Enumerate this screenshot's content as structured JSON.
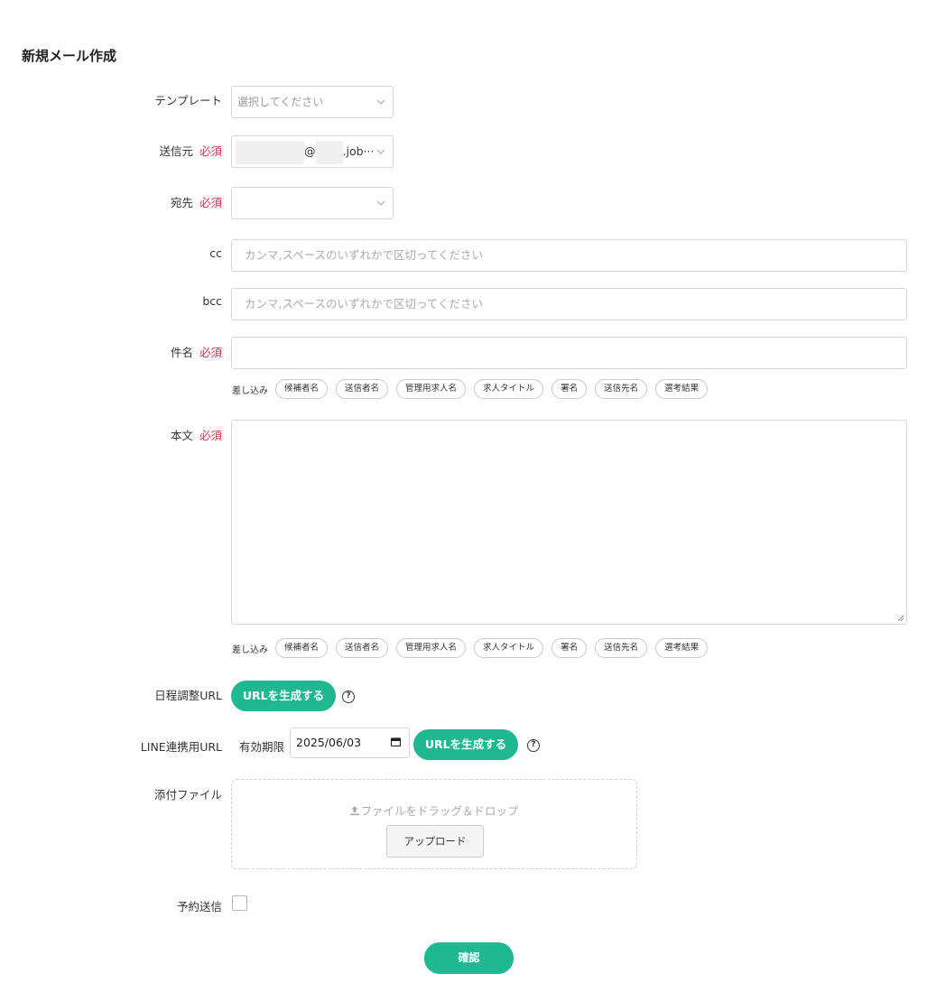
{
  "page": {
    "title": "新規メール作成"
  },
  "template": {
    "label": "テンプレート",
    "placeholder": "選択してください"
  },
  "from": {
    "label": "送信元",
    "required": "必須",
    "value_at": "@",
    "value_domain": ".job···"
  },
  "to": {
    "label": "宛先",
    "required": "必須",
    "value": ""
  },
  "cc": {
    "label": "cc",
    "placeholder": "カンマ,スペースのいずれかで区切ってください"
  },
  "bcc": {
    "label": "bcc",
    "placeholder": "カンマ,スペースのいずれかで区切ってください"
  },
  "subject": {
    "label": "件名",
    "required": "必須",
    "insert_label": "差し込み",
    "chips": [
      "候補者名",
      "送信者名",
      "管理用求人名",
      "求人タイトル",
      "署名",
      "送信先名",
      "選考結果"
    ]
  },
  "body": {
    "label": "本文",
    "required": "必須",
    "insert_label": "差し込み",
    "chips": [
      "候補者名",
      "送信者名",
      "管理用求人名",
      "求人タイトル",
      "署名",
      "送信先名",
      "選考結果"
    ]
  },
  "schedule_url": {
    "label": "日程調整URL",
    "button": "URLを生成する",
    "help": "?"
  },
  "line_url": {
    "label": "LINE連携用URL",
    "expiry_label": "有効期限",
    "date": "2025/06/03",
    "button": "URLを生成する",
    "help": "?"
  },
  "attachment": {
    "label": "添付ファイル",
    "drop_text": "ファイルをドラッグ＆ドロップ",
    "upload_button": "アップロード"
  },
  "scheduled_send": {
    "label": "予約送信",
    "checked": false
  },
  "confirm": {
    "label": "確認"
  },
  "colors": {
    "accent": "#1fb890",
    "required": "#e0314b",
    "border": "#d6d6d6"
  }
}
